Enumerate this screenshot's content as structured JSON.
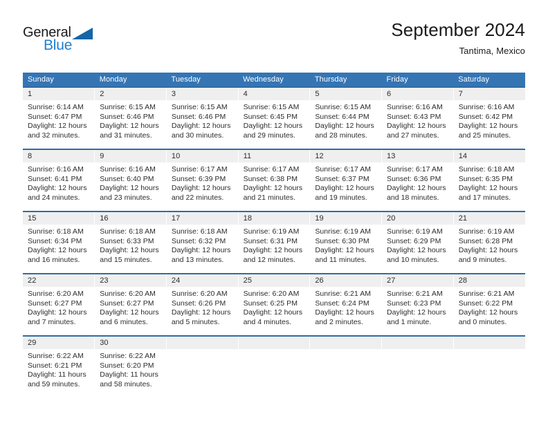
{
  "brand": {
    "name_part1": "General",
    "name_part2": "Blue",
    "triangle_icon": "triangle-icon",
    "accent_color": "#1f7fd0",
    "logo_triangle_color": "#1565a8"
  },
  "header": {
    "title": "September 2024",
    "subtitle": "Tantima, Mexico"
  },
  "colors": {
    "header_row_background": "#3575b4",
    "row_top_border": "#2e6da4",
    "day_number_background": "#efefef",
    "text": "#2b2b2b",
    "page_background": "#ffffff"
  },
  "weekdays": [
    "Sunday",
    "Monday",
    "Tuesday",
    "Wednesday",
    "Thursday",
    "Friday",
    "Saturday"
  ],
  "labels": {
    "sunrise_prefix": "Sunrise:",
    "sunset_prefix": "Sunset:",
    "daylight_prefix": "Daylight:"
  },
  "weeks": [
    [
      {
        "day": "1",
        "sunrise": "Sunrise: 6:14 AM",
        "sunset": "Sunset: 6:47 PM",
        "daylight_line1": "Daylight: 12 hours",
        "daylight_line2": "and 32 minutes."
      },
      {
        "day": "2",
        "sunrise": "Sunrise: 6:15 AM",
        "sunset": "Sunset: 6:46 PM",
        "daylight_line1": "Daylight: 12 hours",
        "daylight_line2": "and 31 minutes."
      },
      {
        "day": "3",
        "sunrise": "Sunrise: 6:15 AM",
        "sunset": "Sunset: 6:46 PM",
        "daylight_line1": "Daylight: 12 hours",
        "daylight_line2": "and 30 minutes."
      },
      {
        "day": "4",
        "sunrise": "Sunrise: 6:15 AM",
        "sunset": "Sunset: 6:45 PM",
        "daylight_line1": "Daylight: 12 hours",
        "daylight_line2": "and 29 minutes."
      },
      {
        "day": "5",
        "sunrise": "Sunrise: 6:15 AM",
        "sunset": "Sunset: 6:44 PM",
        "daylight_line1": "Daylight: 12 hours",
        "daylight_line2": "and 28 minutes."
      },
      {
        "day": "6",
        "sunrise": "Sunrise: 6:16 AM",
        "sunset": "Sunset: 6:43 PM",
        "daylight_line1": "Daylight: 12 hours",
        "daylight_line2": "and 27 minutes."
      },
      {
        "day": "7",
        "sunrise": "Sunrise: 6:16 AM",
        "sunset": "Sunset: 6:42 PM",
        "daylight_line1": "Daylight: 12 hours",
        "daylight_line2": "and 25 minutes."
      }
    ],
    [
      {
        "day": "8",
        "sunrise": "Sunrise: 6:16 AM",
        "sunset": "Sunset: 6:41 PM",
        "daylight_line1": "Daylight: 12 hours",
        "daylight_line2": "and 24 minutes."
      },
      {
        "day": "9",
        "sunrise": "Sunrise: 6:16 AM",
        "sunset": "Sunset: 6:40 PM",
        "daylight_line1": "Daylight: 12 hours",
        "daylight_line2": "and 23 minutes."
      },
      {
        "day": "10",
        "sunrise": "Sunrise: 6:17 AM",
        "sunset": "Sunset: 6:39 PM",
        "daylight_line1": "Daylight: 12 hours",
        "daylight_line2": "and 22 minutes."
      },
      {
        "day": "11",
        "sunrise": "Sunrise: 6:17 AM",
        "sunset": "Sunset: 6:38 PM",
        "daylight_line1": "Daylight: 12 hours",
        "daylight_line2": "and 21 minutes."
      },
      {
        "day": "12",
        "sunrise": "Sunrise: 6:17 AM",
        "sunset": "Sunset: 6:37 PM",
        "daylight_line1": "Daylight: 12 hours",
        "daylight_line2": "and 19 minutes."
      },
      {
        "day": "13",
        "sunrise": "Sunrise: 6:17 AM",
        "sunset": "Sunset: 6:36 PM",
        "daylight_line1": "Daylight: 12 hours",
        "daylight_line2": "and 18 minutes."
      },
      {
        "day": "14",
        "sunrise": "Sunrise: 6:18 AM",
        "sunset": "Sunset: 6:35 PM",
        "daylight_line1": "Daylight: 12 hours",
        "daylight_line2": "and 17 minutes."
      }
    ],
    [
      {
        "day": "15",
        "sunrise": "Sunrise: 6:18 AM",
        "sunset": "Sunset: 6:34 PM",
        "daylight_line1": "Daylight: 12 hours",
        "daylight_line2": "and 16 minutes."
      },
      {
        "day": "16",
        "sunrise": "Sunrise: 6:18 AM",
        "sunset": "Sunset: 6:33 PM",
        "daylight_line1": "Daylight: 12 hours",
        "daylight_line2": "and 15 minutes."
      },
      {
        "day": "17",
        "sunrise": "Sunrise: 6:18 AM",
        "sunset": "Sunset: 6:32 PM",
        "daylight_line1": "Daylight: 12 hours",
        "daylight_line2": "and 13 minutes."
      },
      {
        "day": "18",
        "sunrise": "Sunrise: 6:19 AM",
        "sunset": "Sunset: 6:31 PM",
        "daylight_line1": "Daylight: 12 hours",
        "daylight_line2": "and 12 minutes."
      },
      {
        "day": "19",
        "sunrise": "Sunrise: 6:19 AM",
        "sunset": "Sunset: 6:30 PM",
        "daylight_line1": "Daylight: 12 hours",
        "daylight_line2": "and 11 minutes."
      },
      {
        "day": "20",
        "sunrise": "Sunrise: 6:19 AM",
        "sunset": "Sunset: 6:29 PM",
        "daylight_line1": "Daylight: 12 hours",
        "daylight_line2": "and 10 minutes."
      },
      {
        "day": "21",
        "sunrise": "Sunrise: 6:19 AM",
        "sunset": "Sunset: 6:28 PM",
        "daylight_line1": "Daylight: 12 hours",
        "daylight_line2": "and 9 minutes."
      }
    ],
    [
      {
        "day": "22",
        "sunrise": "Sunrise: 6:20 AM",
        "sunset": "Sunset: 6:27 PM",
        "daylight_line1": "Daylight: 12 hours",
        "daylight_line2": "and 7 minutes."
      },
      {
        "day": "23",
        "sunrise": "Sunrise: 6:20 AM",
        "sunset": "Sunset: 6:27 PM",
        "daylight_line1": "Daylight: 12 hours",
        "daylight_line2": "and 6 minutes."
      },
      {
        "day": "24",
        "sunrise": "Sunrise: 6:20 AM",
        "sunset": "Sunset: 6:26 PM",
        "daylight_line1": "Daylight: 12 hours",
        "daylight_line2": "and 5 minutes."
      },
      {
        "day": "25",
        "sunrise": "Sunrise: 6:20 AM",
        "sunset": "Sunset: 6:25 PM",
        "daylight_line1": "Daylight: 12 hours",
        "daylight_line2": "and 4 minutes."
      },
      {
        "day": "26",
        "sunrise": "Sunrise: 6:21 AM",
        "sunset": "Sunset: 6:24 PM",
        "daylight_line1": "Daylight: 12 hours",
        "daylight_line2": "and 2 minutes."
      },
      {
        "day": "27",
        "sunrise": "Sunrise: 6:21 AM",
        "sunset": "Sunset: 6:23 PM",
        "daylight_line1": "Daylight: 12 hours",
        "daylight_line2": "and 1 minute."
      },
      {
        "day": "28",
        "sunrise": "Sunrise: 6:21 AM",
        "sunset": "Sunset: 6:22 PM",
        "daylight_line1": "Daylight: 12 hours",
        "daylight_line2": "and 0 minutes."
      }
    ],
    [
      {
        "day": "29",
        "sunrise": "Sunrise: 6:22 AM",
        "sunset": "Sunset: 6:21 PM",
        "daylight_line1": "Daylight: 11 hours",
        "daylight_line2": "and 59 minutes."
      },
      {
        "day": "30",
        "sunrise": "Sunrise: 6:22 AM",
        "sunset": "Sunset: 6:20 PM",
        "daylight_line1": "Daylight: 11 hours",
        "daylight_line2": "and 58 minutes."
      },
      {
        "day": "",
        "sunrise": "",
        "sunset": "",
        "daylight_line1": "",
        "daylight_line2": "",
        "empty": true
      },
      {
        "day": "",
        "sunrise": "",
        "sunset": "",
        "daylight_line1": "",
        "daylight_line2": "",
        "empty": true
      },
      {
        "day": "",
        "sunrise": "",
        "sunset": "",
        "daylight_line1": "",
        "daylight_line2": "",
        "empty": true
      },
      {
        "day": "",
        "sunrise": "",
        "sunset": "",
        "daylight_line1": "",
        "daylight_line2": "",
        "empty": true
      },
      {
        "day": "",
        "sunrise": "",
        "sunset": "",
        "daylight_line1": "",
        "daylight_line2": "",
        "empty": true
      }
    ]
  ]
}
